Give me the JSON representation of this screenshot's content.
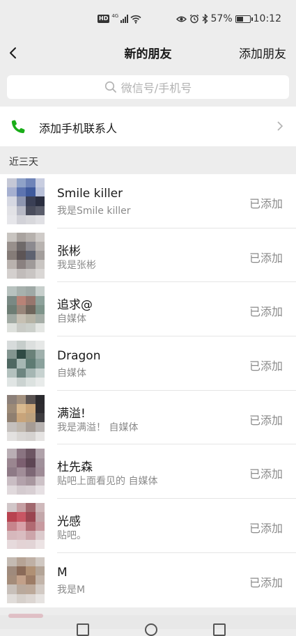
{
  "status_bar": {
    "hd": "HD",
    "net": "4G",
    "battery_percent": "57%",
    "battery_level": 0.57,
    "time": "10:12"
  },
  "navbar": {
    "title": "新的朋友",
    "action": "添加朋友"
  },
  "search": {
    "placeholder": "微信号/手机号"
  },
  "phone_contacts": {
    "label": "添加手机联系人"
  },
  "section": {
    "title": "近三天"
  },
  "colors": {
    "background": "#ededed",
    "phone_icon": "#1aad19",
    "secondary_text": "#8a8a8a"
  },
  "friends": [
    {
      "name": "Smile killer",
      "message": "我是Smile killer",
      "status": "已添加",
      "avatar": [
        "#c5c8d6",
        "#8fa2c8",
        "#6f84b8",
        "#c8cde0",
        "#a6b0d0",
        "#5d74b0",
        "#3f5a9c",
        "#b8c0d8",
        "#d6d8e2",
        "#8e96b0",
        "#3a3f55",
        "#2a2e40",
        "#e2e2e6",
        "#b7b9c5",
        "#4a4d5c",
        "#5a5d6b",
        "#e6e6ea",
        "#d2d2d8",
        "#d8d8dc",
        "#e0e0e4"
      ]
    },
    {
      "name": "张彬",
      "message": "我是张彬",
      "status": "已添加",
      "avatar": [
        "#c8c4c0",
        "#a9a39f",
        "#b6b1ad",
        "#cfcbc8",
        "#98908c",
        "#6f6a6a",
        "#8c8a8f",
        "#b8b3b0",
        "#857c78",
        "#5d5556",
        "#5e6270",
        "#a39e9c",
        "#b9b2ae",
        "#8a8180",
        "#9f9a99",
        "#c9c5c2",
        "#d4d0ce",
        "#c1bcba",
        "#c9c5c3",
        "#dad7d5"
      ]
    },
    {
      "name": "追求@",
      "message": "自媒体",
      "status": "已添加",
      "avatar": [
        "#b8c2bf",
        "#a7b1ad",
        "#9fa9a6",
        "#c7cfcc",
        "#7a8984",
        "#b88377",
        "#97766d",
        "#8ea29b",
        "#6d7d74",
        "#98867a",
        "#6f665c",
        "#7e948a",
        "#a1aaa3",
        "#c6c0b3",
        "#b6b3a5",
        "#a6aea7",
        "#dde0dc",
        "#c9cbc6",
        "#ccd0cb",
        "#e4e6e3"
      ]
    },
    {
      "name": "Dragon",
      "message": "自媒体",
      "status": "已添加",
      "avatar": [
        "#d7dbdb",
        "#c6cdcb",
        "#dcdfde",
        "#e6e8e7",
        "#839590",
        "#2f4a44",
        "#6a8179",
        "#9fb0ac",
        "#4f6862",
        "#a6b7b3",
        "#5e7b73",
        "#8aa19c",
        "#b3c1be",
        "#6d8580",
        "#a5b6b3",
        "#c7d2d0",
        "#e0e5e4",
        "#cbd3d1",
        "#dce2e0",
        "#e8ebea"
      ]
    },
    {
      "name": "满溢!",
      "message": "我是满溢！ 自媒体",
      "status": "已添加",
      "avatar": [
        "#8c8079",
        "#a3917f",
        "#5a5352",
        "#2b2a2e",
        "#9c8a77",
        "#d8b98f",
        "#c9a57a",
        "#2e2c30",
        "#8f7f70",
        "#c8a47a",
        "#bda27f",
        "#3e3c3f",
        "#c5c0bd",
        "#bfb7ae",
        "#a69c95",
        "#b8b3b1",
        "#e3e1e0",
        "#d9d6d4",
        "#d5d2d0",
        "#e6e4e3"
      ]
    },
    {
      "name": "杜先森",
      "message": "贴吧上面看见的 自媒体",
      "status": "已添加",
      "avatar": [
        "#b9aeb4",
        "#8a7481",
        "#6d5663",
        "#b0a2aa",
        "#9a8690",
        "#7c5f70",
        "#5e4654",
        "#a0909a",
        "#8e7a86",
        "#a18d98",
        "#7d6775",
        "#9e8b96",
        "#c9bdc3",
        "#b3a2ab",
        "#a8979f",
        "#cdc2c7",
        "#e0d9dc",
        "#d4cbcf",
        "#d8cfd3",
        "#e6e0e3"
      ]
    },
    {
      "name": "光感",
      "message": "贴吧。",
      "status": "已添加",
      "avatar": [
        "#d1c6c8",
        "#c59fa3",
        "#a1686e",
        "#cfb9bb",
        "#b84350",
        "#c85663",
        "#9a4550",
        "#c3a7aa",
        "#c7848c",
        "#d8a1a8",
        "#b16a72",
        "#c89aa0",
        "#d6b8bc",
        "#d9bcc0",
        "#cca5aa",
        "#dccbcd",
        "#e6dadc",
        "#e3d3d5",
        "#e2d4d6",
        "#ece3e4"
      ]
    },
    {
      "name": "M",
      "message": "我是M",
      "status": "已添加",
      "avatar": [
        "#c4bab2",
        "#b6a395",
        "#bfb0a5",
        "#d0c8c2",
        "#9f8a7c",
        "#8a6a58",
        "#b09074",
        "#b3a497",
        "#a48c7a",
        "#c2a089",
        "#9d7c66",
        "#c2b4a9",
        "#c8c0ba",
        "#b9a99c",
        "#bca99a",
        "#d2cac4",
        "#e0dcd9",
        "#d6d0cb",
        "#dcd6d2",
        "#e6e3e1"
      ]
    }
  ]
}
